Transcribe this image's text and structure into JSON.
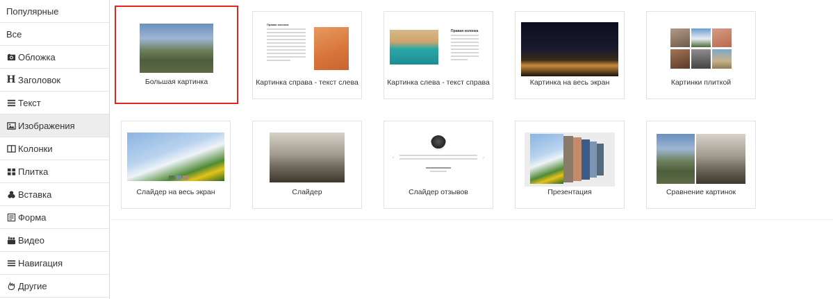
{
  "sidebar": {
    "items": [
      {
        "label": "Популярные",
        "icon": ""
      },
      {
        "label": "Все",
        "icon": ""
      },
      {
        "label": "Обложка",
        "icon": "camera-icon"
      },
      {
        "label": "Заголовок",
        "icon": "heading-icon"
      },
      {
        "label": "Текст",
        "icon": "text-lines-icon"
      },
      {
        "label": "Изображения",
        "icon": "image-icon",
        "active": true
      },
      {
        "label": "Колонки",
        "icon": "columns-icon"
      },
      {
        "label": "Плитка",
        "icon": "grid-icon"
      },
      {
        "label": "Вставка",
        "icon": "puzzle-icon"
      },
      {
        "label": "Форма",
        "icon": "form-icon"
      },
      {
        "label": "Видео",
        "icon": "youtube-icon"
      },
      {
        "label": "Навигация",
        "icon": "menu-icon"
      },
      {
        "label": "Другие",
        "icon": "hand-icon"
      }
    ]
  },
  "templates": [
    {
      "label": "Большая картинка",
      "selected": true
    },
    {
      "label": "Картинка справа - текст слева"
    },
    {
      "label": "Картинка слева - текст справа"
    },
    {
      "label": "Картинка на весь экран"
    },
    {
      "label": "Картинки плиткой"
    },
    {
      "label": "Слайдер на весь экран"
    },
    {
      "label": "Слайдер"
    },
    {
      "label": "Слайдер отзывов"
    },
    {
      "label": "Презентация"
    },
    {
      "label": "Сравнение картинок"
    }
  ],
  "thumb_text": {
    "right_col_title": "Правая колонка"
  },
  "colors": {
    "selected_border": "#e0251b",
    "active_bg": "#ededed"
  }
}
